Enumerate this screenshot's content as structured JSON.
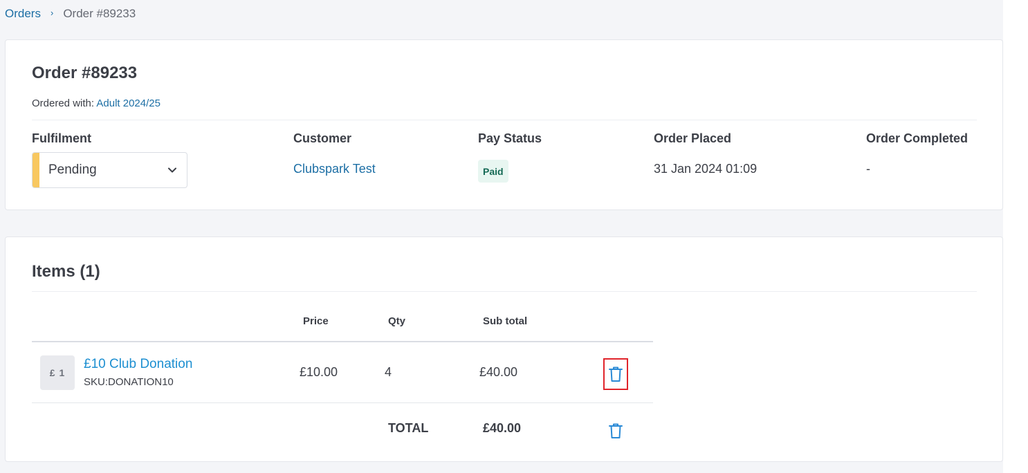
{
  "breadcrumb": {
    "parent": "Orders",
    "separator": "›",
    "current": "Order #89233"
  },
  "order": {
    "title": "Order #89233",
    "ordered_with_label": "Ordered with:",
    "ordered_with_value": "Adult 2024/25",
    "columns": {
      "fulfilment": {
        "label": "Fulfilment",
        "value": "Pending",
        "status_color": "#f8c860"
      },
      "customer": {
        "label": "Customer",
        "value": "Clubspark Test"
      },
      "pay_status": {
        "label": "Pay Status",
        "value": "Paid"
      },
      "order_placed": {
        "label": "Order Placed",
        "value": "31 Jan 2024 01:09"
      },
      "order_completed": {
        "label": "Order Completed",
        "value": "-"
      }
    }
  },
  "items": {
    "title": "Items (1)",
    "headers": {
      "price": "Price",
      "qty": "Qty",
      "subtotal": "Sub total"
    },
    "rows": [
      {
        "thumb": "£ 1",
        "name": "£10 Club Donation",
        "sku": "SKU:DONATION10",
        "price": "£10.00",
        "qty": "4",
        "subtotal": "£40.00"
      }
    ],
    "total_label": "TOTAL",
    "total_value": "£40.00"
  },
  "icons": {
    "delete": "trash-icon",
    "dropdown": "chevron-down-icon",
    "breadcrumb_sep": "chevron-right-icon"
  },
  "colors": {
    "link": "#1d6fa5",
    "item_link": "#1d8fd1",
    "paid_bg": "#e8f6f1",
    "paid_text": "#166a55",
    "highlight_border": "#e0242b"
  }
}
